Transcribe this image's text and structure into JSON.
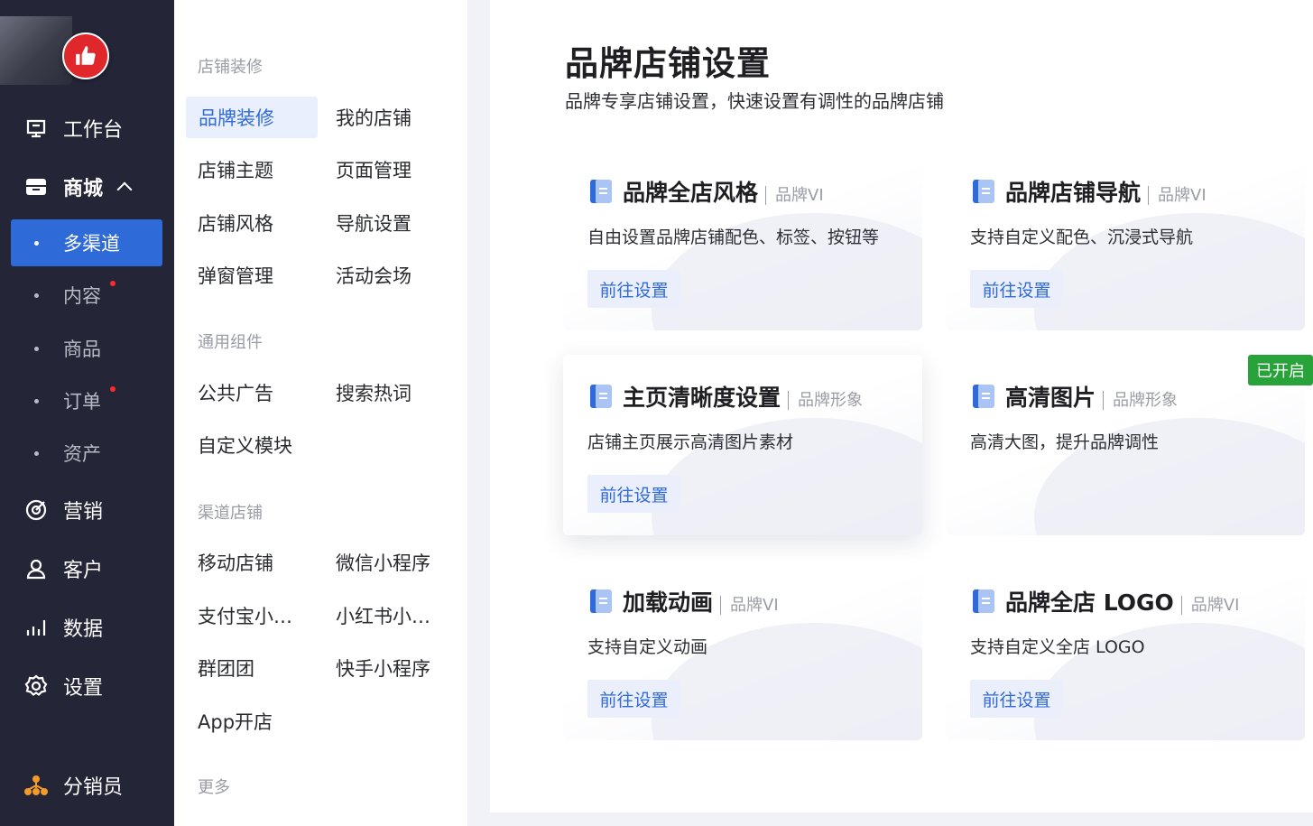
{
  "sidebar": {
    "logo_icon": "thumbs-up-icon",
    "nav": [
      {
        "label": "工作台",
        "icon": "workbench-icon"
      },
      {
        "label": "商城",
        "icon": "store-icon"
      },
      {
        "label": "营销",
        "icon": "marketing-icon"
      },
      {
        "label": "客户",
        "icon": "customer-icon"
      },
      {
        "label": "数据",
        "icon": "data-chart-icon"
      },
      {
        "label": "设置",
        "icon": "gear-icon"
      },
      {
        "label": "分销员",
        "icon": "distributor-icon"
      }
    ],
    "sub": [
      {
        "label": "多渠道",
        "active": true
      },
      {
        "label": "内容",
        "has_badge": true
      },
      {
        "label": "商品"
      },
      {
        "label": "订单",
        "has_badge": true
      },
      {
        "label": "资产"
      }
    ]
  },
  "menu": {
    "groups": [
      "店铺装修",
      "通用组件",
      "渠道店铺",
      "更多"
    ],
    "links": [
      "品牌装修",
      "我的店铺",
      "店铺主题",
      "页面管理",
      "店铺风格",
      "导航设置",
      "弹窗管理",
      "活动会场",
      "公共广告",
      "搜索热词",
      "自定义模块",
      "移动店铺",
      "微信小程序",
      "支付宝小…",
      "小红书小…",
      "群团团",
      "快手小程序",
      "App开店"
    ]
  },
  "main": {
    "title": "品牌店铺设置",
    "subtitle": "品牌专享店铺设置，快速设置有调性的品牌店铺",
    "cards": [
      {
        "title": "品牌全店风格",
        "tag": "品牌VI",
        "desc": "自由设置品牌店铺配色、标签、按钮等",
        "button": "前往设置"
      },
      {
        "title": "品牌店铺导航",
        "tag": "品牌VI",
        "desc": "支持自定义配色、沉浸式导航",
        "button": "前往设置"
      },
      {
        "title": "主页清晰度设置",
        "tag": "品牌形象",
        "desc": "店铺主页展示高清图片素材",
        "button": "前往设置"
      },
      {
        "title": "高清图片",
        "tag": "品牌形象",
        "desc": "高清大图，提升品牌调性",
        "status_badge": "已开启"
      },
      {
        "title": "加载动画",
        "tag": "品牌VI",
        "desc": "支持自定义动画",
        "button": "前往设置"
      },
      {
        "title": "品牌全店 LOGO",
        "tag": "品牌VI",
        "desc": "支持自定义全店 LOGO",
        "button": "前往设置"
      }
    ]
  },
  "colors": {
    "sidebar_bg": "#242638",
    "accent": "#2f6ad9",
    "badge_green": "#27a33a",
    "notify_red": "#ff2a2a"
  }
}
